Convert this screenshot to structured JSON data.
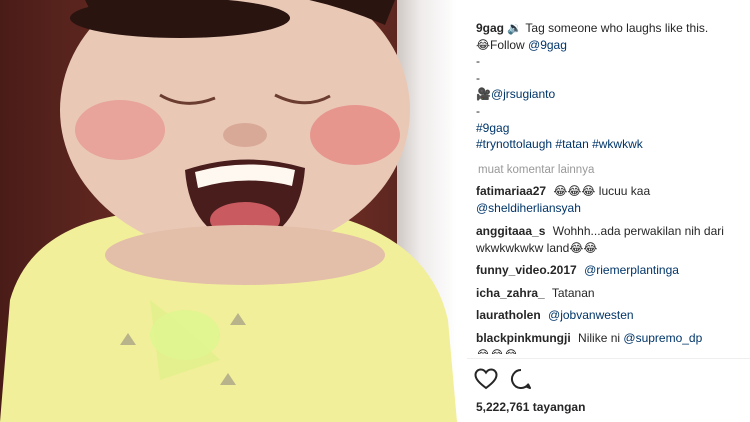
{
  "post": {
    "author": "9gag",
    "caption_line1": "🔉 Tag someone who laughs like this.",
    "caption_line2_prefix": "😂Follow ",
    "caption_line2_link": "@9gag",
    "dash1": "-",
    "dash2": "-",
    "credit_prefix": "🎥",
    "credit_link": "@jrsugianto",
    "dash3": "-",
    "hashtag_line1": "#9gag",
    "hashtag_line2": "#trynottolaugh #tatan #wkwkwk"
  },
  "load_more": "muat komentar lainnya",
  "comments": [
    {
      "user": "fatimariaa27",
      "text": "😂😂😂 lucuu kaa",
      "link": "@sheldiherliansyah",
      "link_after": true
    },
    {
      "user": "anggitaaa_s",
      "text": "Wohhh...ada perwakilan nih dari wkwkwkwkw land😂😂",
      "link": "",
      "link_after": false
    },
    {
      "user": "funny_video.2017",
      "text": "",
      "link": "@riemerplantinga",
      "link_after": false
    },
    {
      "user": "icha_zahra_",
      "text": "Tatanan",
      "link": "",
      "link_after": false
    },
    {
      "user": "lauratholen",
      "text": "",
      "link": "@jobvanwesten",
      "link_after": false
    },
    {
      "user": "blackpinkmungji",
      "text": "Nilike ni",
      "link": "@supremo_dp",
      "link_after": false,
      "trail": "😂😂😂"
    }
  ],
  "views": "5,222,761 tayangan",
  "icons": {
    "like": "heart-outline-icon",
    "comment": "speech-bubble-icon"
  }
}
